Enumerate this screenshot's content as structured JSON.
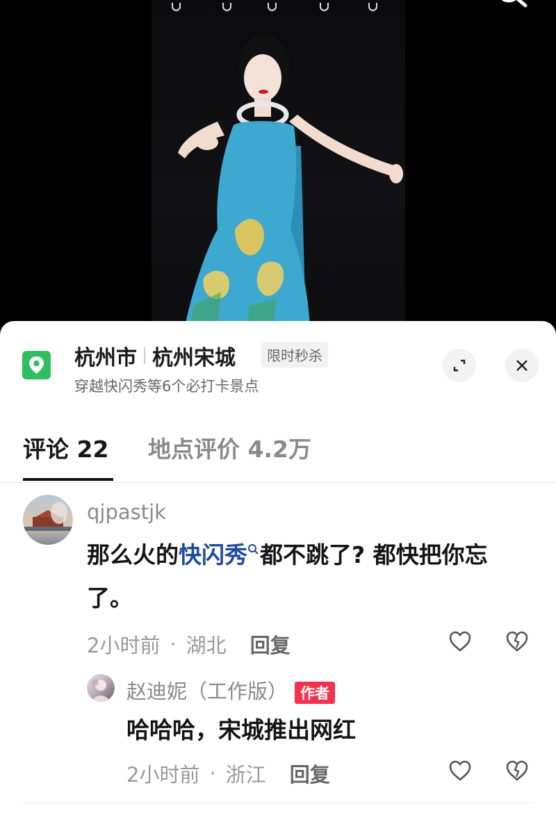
{
  "video": {
    "dancer_dress_color": "#3da9d1"
  },
  "poi": {
    "city": "杭州市",
    "place": "杭州宋城",
    "tag": "限时秒杀",
    "subtitle": "穿越快闪秀等6个必打卡景点",
    "pin_color": "#2fbe61"
  },
  "tabs": [
    {
      "label": "评论 22",
      "active": true
    },
    {
      "label": "地点评价 4.2万",
      "active": false
    }
  ],
  "comments": [
    {
      "username": "qjpastjk",
      "text_before": "那么火的",
      "highlight": "快闪秀",
      "text_after": "都不跳了? 都快把你忘了。",
      "time": "2小时前",
      "dot": "·",
      "location": "湖北",
      "reply_label": "回复"
    },
    {
      "username": "赵迪妮（工作版）",
      "badge": "作者",
      "text": "哈哈哈，宋城推出网红",
      "time": "2小时前",
      "dot": "·",
      "location": "浙江",
      "reply_label": "回复"
    }
  ],
  "colors": {
    "highlight": "#1f4a9c",
    "author_badge": "#f5324d"
  }
}
